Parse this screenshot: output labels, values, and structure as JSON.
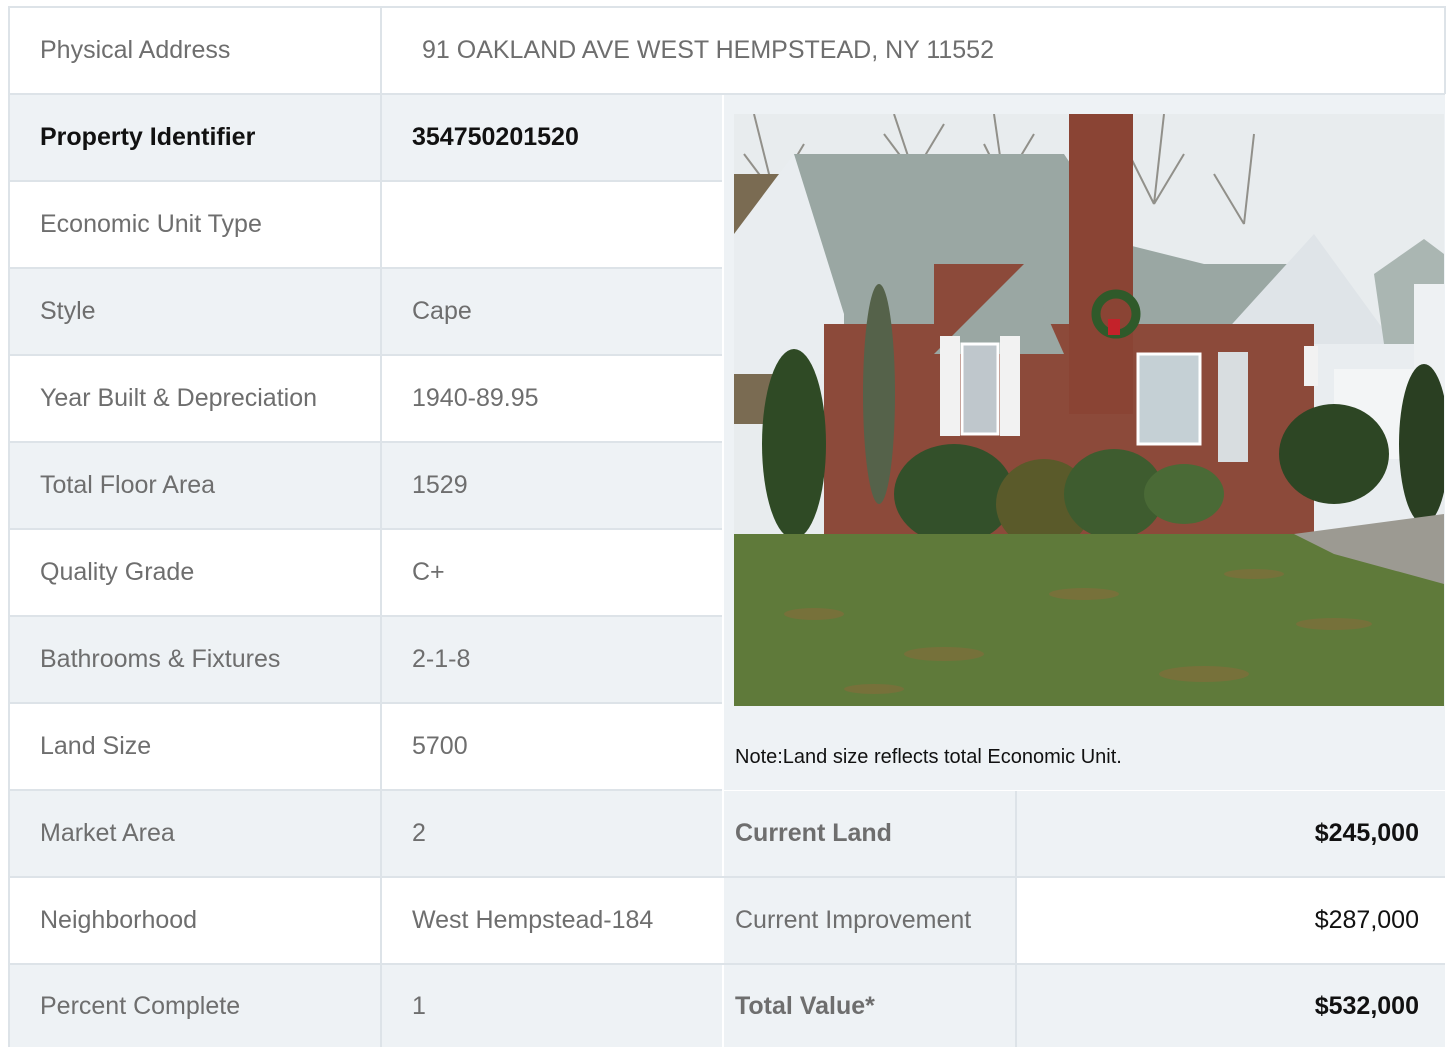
{
  "address": {
    "label": "Physical Address",
    "value": "91  OAKLAND AVE  WEST HEMPSTEAD, NY  11552"
  },
  "details": [
    {
      "label": "Property Identifier",
      "value": "354750201520"
    },
    {
      "label": "Economic Unit Type",
      "value": ""
    },
    {
      "label": "Style",
      "value": "Cape"
    },
    {
      "label": "Year Built & Depreciation",
      "value": "1940-89.95"
    },
    {
      "label": "Total Floor Area",
      "value": "1529"
    },
    {
      "label": "Quality Grade",
      "value": "C+"
    },
    {
      "label": "Bathrooms & Fixtures",
      "value": "2-1-8"
    },
    {
      "label": "Land Size",
      "value": "5700"
    },
    {
      "label": "Market Area",
      "value": "2"
    },
    {
      "label": "Neighborhood",
      "value": "West Hempstead-184"
    },
    {
      "label": "Percent Complete",
      "value": "1"
    }
  ],
  "note": "Note:Land size reflects total Economic Unit.",
  "values": [
    {
      "label": "Current Land",
      "value": "$245,000"
    },
    {
      "label": "Current Improvement",
      "value": "$287,000"
    },
    {
      "label": "Total Value*",
      "value": "$532,000"
    }
  ],
  "photo_icon": "house-photo"
}
